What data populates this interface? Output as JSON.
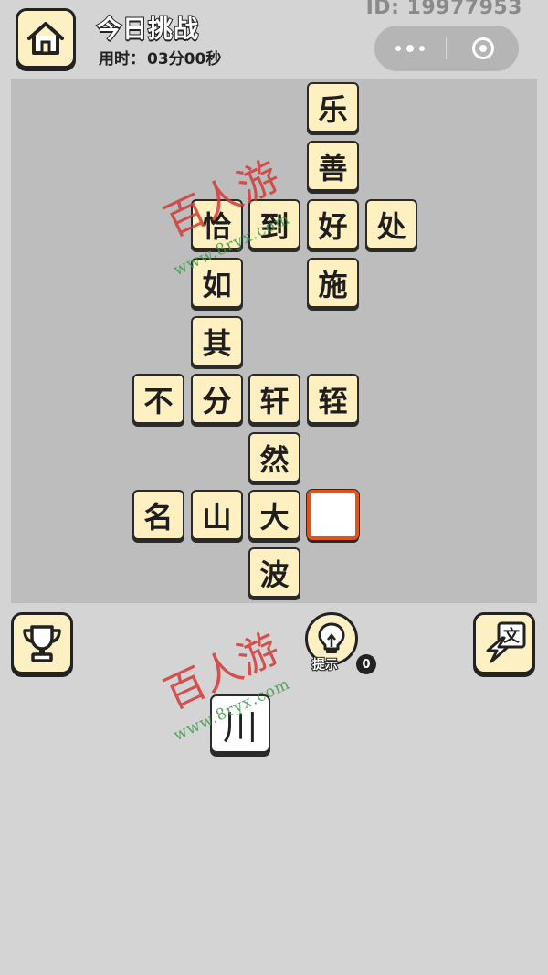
{
  "header": {
    "title": "今日挑战",
    "timer_label": "用时：",
    "timer_value": "03分00秒",
    "user_id": "ID: 19977953",
    "home_icon": "home-icon",
    "more_icon": "more-dots-icon",
    "close_icon": "target-close-icon"
  },
  "board": {
    "tiles": [
      {
        "char": "乐",
        "col": 3,
        "row": 0
      },
      {
        "char": "善",
        "col": 3,
        "row": 1
      },
      {
        "char": "恰",
        "col": 1,
        "row": 2
      },
      {
        "char": "到",
        "col": 2,
        "row": 2
      },
      {
        "char": "好",
        "col": 3,
        "row": 2
      },
      {
        "char": "处",
        "col": 4,
        "row": 2
      },
      {
        "char": "如",
        "col": 1,
        "row": 3
      },
      {
        "char": "施",
        "col": 3,
        "row": 3
      },
      {
        "char": "其",
        "col": 1,
        "row": 4
      },
      {
        "char": "不",
        "col": 0,
        "row": 5
      },
      {
        "char": "分",
        "col": 1,
        "row": 5
      },
      {
        "char": "轩",
        "col": 2,
        "row": 5
      },
      {
        "char": "轾",
        "col": 3,
        "row": 5
      },
      {
        "char": "然",
        "col": 2,
        "row": 6
      },
      {
        "char": "名",
        "col": 0,
        "row": 7
      },
      {
        "char": "山",
        "col": 1,
        "row": 7
      },
      {
        "char": "大",
        "col": 2,
        "row": 7
      },
      {
        "char": "",
        "col": 3,
        "row": 7,
        "selected": true
      },
      {
        "char": "波",
        "col": 2,
        "row": 8
      }
    ]
  },
  "controls": {
    "trophy_icon": "trophy-icon",
    "hint_label": "提示",
    "hint_count": "0",
    "switch_icon": "switch-text-icon",
    "switch_glyph": "文"
  },
  "candidates": [
    {
      "char": "川"
    }
  ],
  "watermark": {
    "text": "百人游",
    "url": "www.8ryx.com"
  },
  "colors": {
    "tile_fill": "#fef0c1",
    "selected_border": "#e2531b",
    "board_bg": "#bdbdbd",
    "page_bg": "#d4d4d4"
  }
}
